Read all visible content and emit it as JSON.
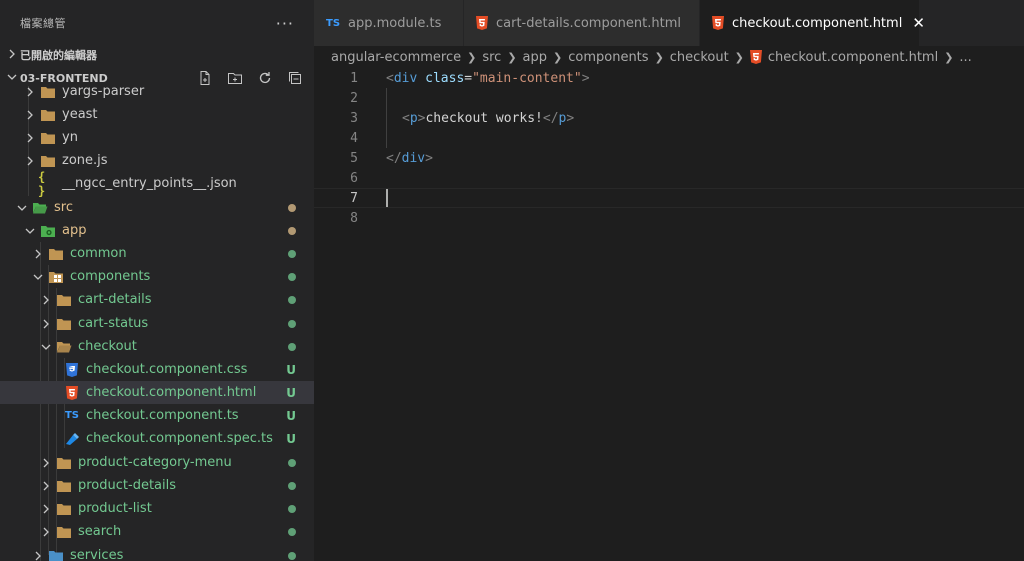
{
  "sidebar": {
    "title": "檔案總管",
    "more_label": "···",
    "open_editors_label": "已開啟的編輯器",
    "root_label": "03-FRONTEND",
    "root_actions": [
      "new-file-icon",
      "new-folder-icon",
      "refresh-icon",
      "collapse-all-icon"
    ],
    "tree": [
      {
        "label": "yargs-parser",
        "kind": "folder",
        "expanded": false,
        "status": ""
      },
      {
        "label": "yeast",
        "kind": "folder",
        "expanded": false,
        "status": ""
      },
      {
        "label": "yn",
        "kind": "folder",
        "expanded": false,
        "status": ""
      },
      {
        "label": "zone.js",
        "kind": "folder",
        "expanded": false,
        "status": ""
      },
      {
        "label": "__ngcc_entry_points__.json",
        "kind": "json",
        "status": ""
      },
      {
        "label": "src",
        "kind": "src-folder",
        "expanded": true,
        "status": "modified"
      },
      {
        "label": "app",
        "kind": "app-folder",
        "expanded": true,
        "status": "modified"
      },
      {
        "label": "common",
        "kind": "folder",
        "expanded": false,
        "status": "untracked"
      },
      {
        "label": "components",
        "kind": "component-folder",
        "expanded": true,
        "status": "untracked"
      },
      {
        "label": "cart-details",
        "kind": "folder",
        "expanded": false,
        "status": "untracked"
      },
      {
        "label": "cart-status",
        "kind": "folder",
        "expanded": false,
        "status": "untracked"
      },
      {
        "label": "checkout",
        "kind": "folder-open",
        "expanded": true,
        "status": "untracked"
      },
      {
        "label": "checkout.component.css",
        "kind": "css",
        "status": "untracked",
        "badge": "U"
      },
      {
        "label": "checkout.component.html",
        "kind": "html",
        "status": "untracked",
        "badge": "U"
      },
      {
        "label": "checkout.component.ts",
        "kind": "ts",
        "status": "untracked",
        "badge": "U"
      },
      {
        "label": "checkout.component.spec.ts",
        "kind": "spec",
        "status": "untracked",
        "badge": "U"
      },
      {
        "label": "product-category-menu",
        "kind": "folder",
        "expanded": false,
        "status": "untracked"
      },
      {
        "label": "product-details",
        "kind": "folder",
        "expanded": false,
        "status": "untracked"
      },
      {
        "label": "product-list",
        "kind": "folder",
        "expanded": false,
        "status": "untracked"
      },
      {
        "label": "search",
        "kind": "folder",
        "expanded": false,
        "status": "untracked"
      },
      {
        "label": "services",
        "kind": "services-folder",
        "expanded": false,
        "status": "untracked"
      }
    ]
  },
  "tabs": [
    {
      "label": "app.module.ts",
      "icon": "typescript-icon",
      "active": false
    },
    {
      "label": "cart-details.component.html",
      "icon": "html5-icon",
      "active": false
    },
    {
      "label": "checkout.component.html",
      "icon": "html5-icon",
      "active": true,
      "close": "✕"
    }
  ],
  "breadcrumb": {
    "items": [
      "angular-ecommerce",
      "src",
      "app",
      "components",
      "checkout",
      "checkout.component.html"
    ],
    "trailing": "..."
  },
  "code": {
    "lines": [
      "1",
      "2",
      "3",
      "4",
      "5",
      "6",
      "7",
      "8"
    ],
    "l1": {
      "open": "<",
      "tag": "div",
      "sp": " ",
      "attr": "class",
      "eq": "=",
      "val": "\"main-content\"",
      "close": ">"
    },
    "l3": {
      "open": "<",
      "tag": "p",
      "close": ">",
      "text": "checkout works!",
      "open2": "</",
      "tag2": "p",
      "close2": ">"
    },
    "l5": {
      "open": "</",
      "tag": "div",
      "close": ">"
    }
  },
  "colors": {
    "modified": "#e2c08d",
    "untracked": "#73c991",
    "html_icon": "#e44d26",
    "css_icon": "#2f73d8",
    "ts_icon": "#3b9cff",
    "folder": "#c09553"
  }
}
